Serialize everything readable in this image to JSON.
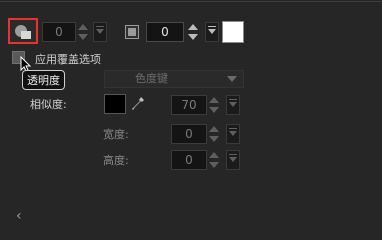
{
  "toolbar": {
    "opacity_value": "0",
    "stroke_value": "0",
    "stroke_color": "#ffffff"
  },
  "overlay": {
    "apply_overlay_label": "应用覆盖选项",
    "tooltip": "透明度",
    "color_key_label": "色度键",
    "similarity_label": "相似度:",
    "similarity_value": "70",
    "width_label": "宽度:",
    "width_value": "0",
    "height_label": "高度:",
    "height_value": "0",
    "key_color": "#000000"
  },
  "footer": {
    "collapse_glyph": "‹"
  },
  "colors": {
    "highlight": "#e8322f",
    "background": "#262626"
  }
}
